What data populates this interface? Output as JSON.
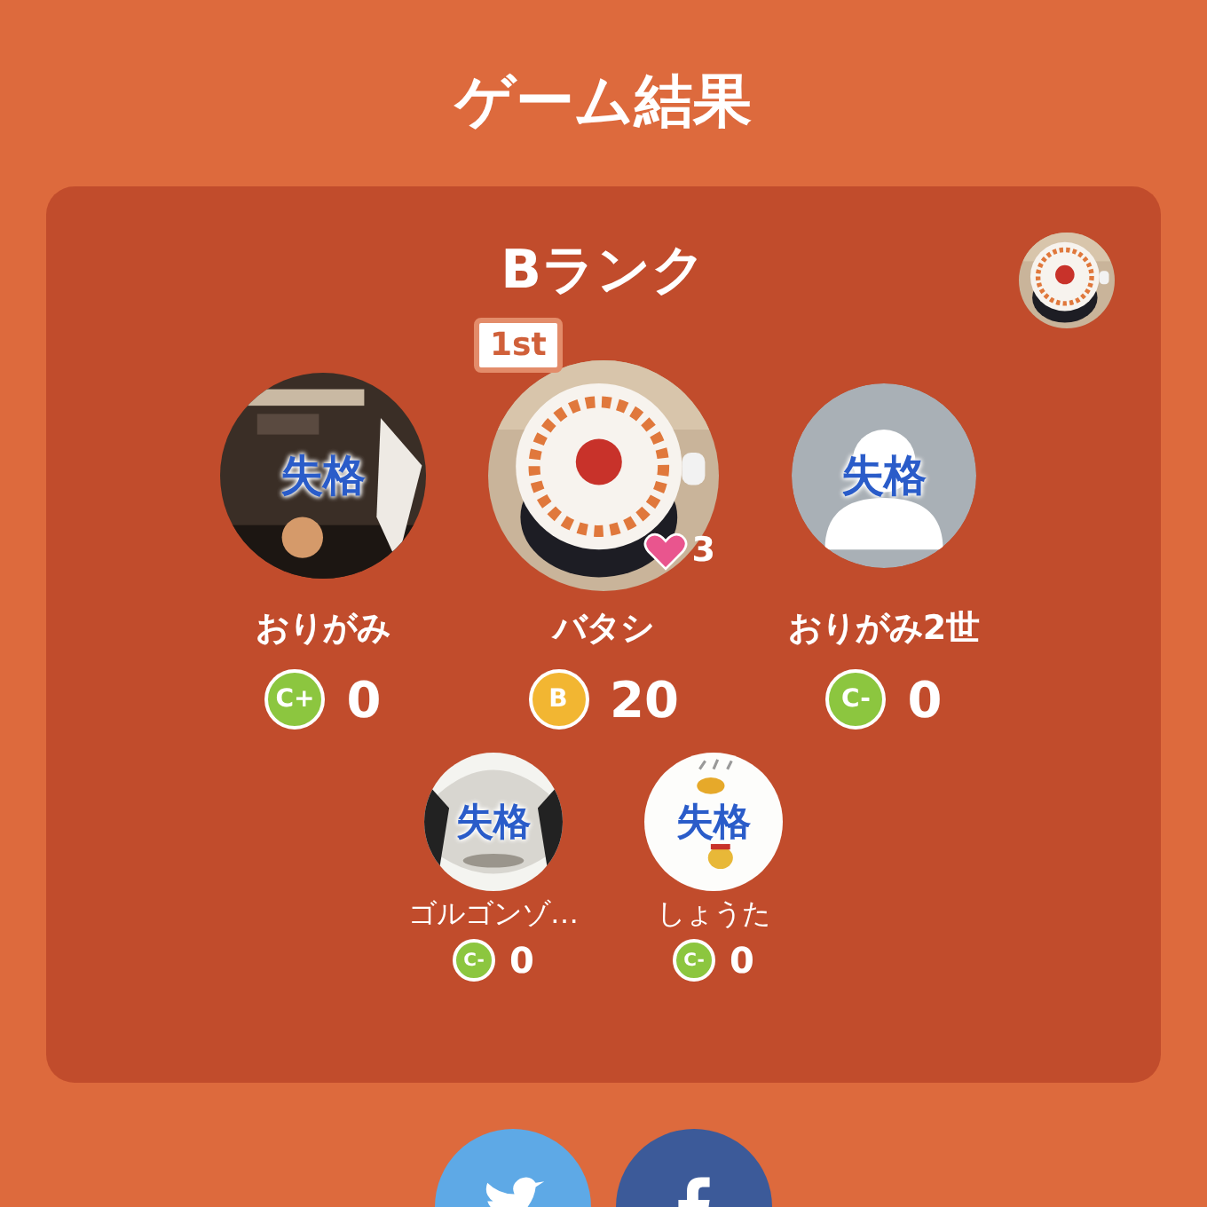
{
  "title": "ゲーム結果",
  "card": {
    "rank_title": "Bランク",
    "players": [
      {
        "name": "おりがみ",
        "status": "失格",
        "rank": "C+",
        "color": "#8cc63f",
        "score": "0"
      },
      {
        "name": "バタシ",
        "place": "1st",
        "likes": "3",
        "rank": "B",
        "color": "#f2b632",
        "score": "20"
      },
      {
        "name": "おりがみ2世",
        "avatar": {
          "kind": "default"
        },
        "status": "失格",
        "rank": "C-",
        "color": "#8cc63f",
        "score": "0"
      }
    ],
    "others": [
      {
        "name": "ゴルゴンゾ…",
        "status": "失格",
        "rank": "C-",
        "color": "#8cc63f",
        "score": "0"
      },
      {
        "name": "しょうた",
        "status": "失格",
        "rank": "C-",
        "color": "#8cc63f",
        "score": "0"
      }
    ]
  },
  "share": {
    "buttons": [
      {
        "kind": "twitter"
      },
      {
        "kind": "facebook"
      }
    ]
  }
}
